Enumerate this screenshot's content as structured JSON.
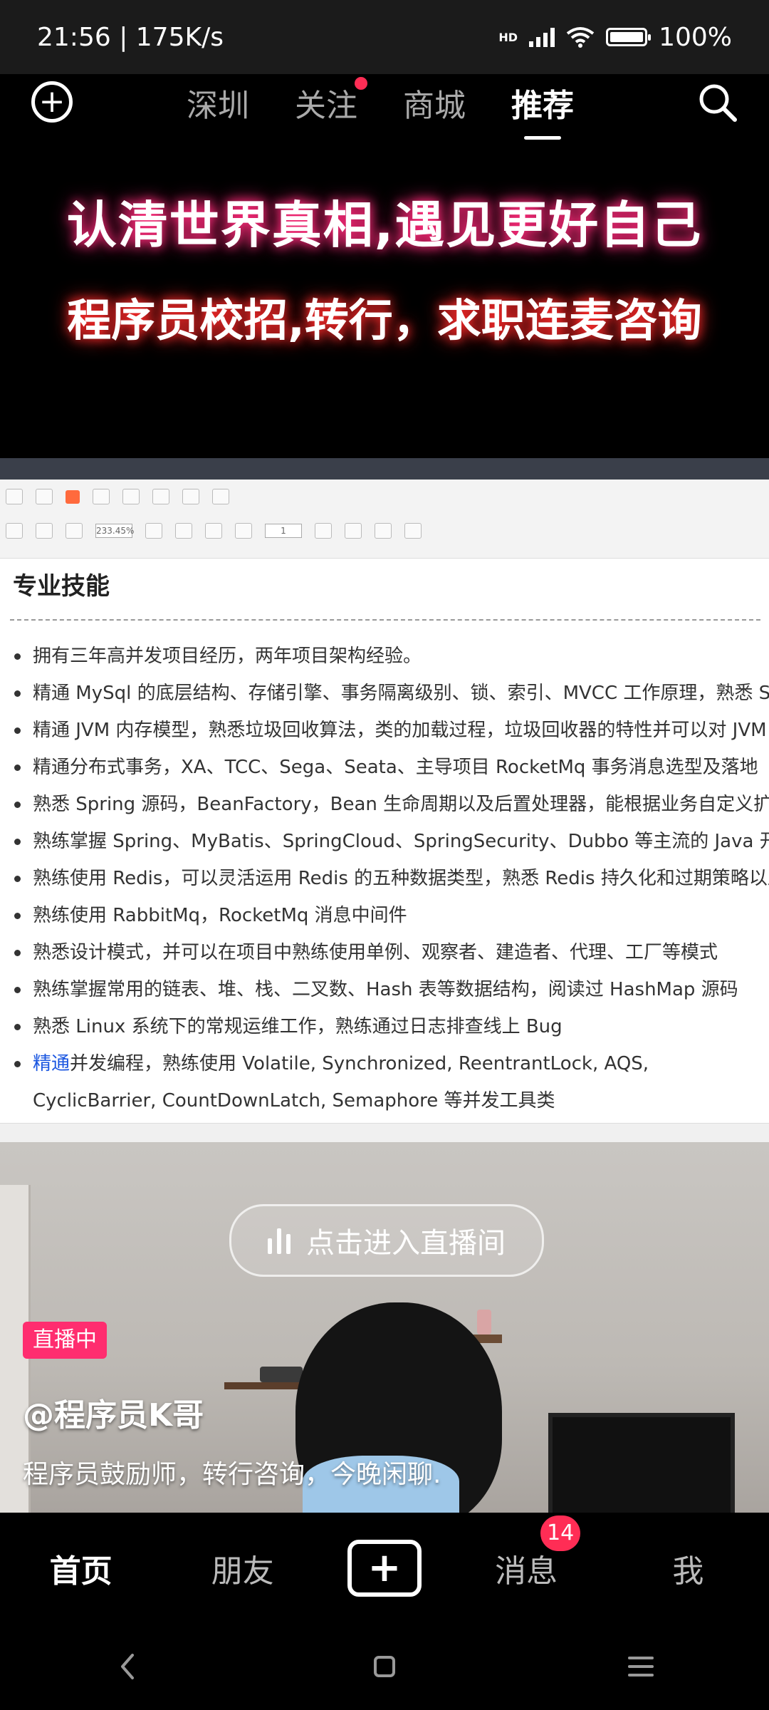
{
  "status_bar": {
    "time_speed": "21:56 | 175K/s",
    "network": "HD",
    "battery": "100%"
  },
  "top_nav": {
    "tabs": [
      {
        "label": "深圳"
      },
      {
        "label": "关注"
      },
      {
        "label": "商城"
      },
      {
        "label": "推荐"
      }
    ],
    "active_tab": "推荐"
  },
  "banner": {
    "line1": "认清世界真相,遇见更好自己",
    "line2": "程序员校招,转行，求职连麦咨询"
  },
  "document": {
    "heading": "专业技能",
    "zoom": "233.45%",
    "page_input": "1",
    "items": [
      "拥有三年高并发项目经历，两年项目架构经验。",
      "精通 MySql 的底层结构、存储引擎、事务隔离级别、锁、索引、MVCC 工作原理，熟悉 Sql 优化工作",
      "精通 JVM 内存模型，熟悉垃圾回收算法，类的加载过程，垃圾回收器的特性并可以对 JVM 进行调优",
      "精通分布式事务，XA、TCC、Sega、Seata、主导项目 RocketMq 事务消息选型及落地",
      "熟悉 Spring 源码，BeanFactory，Bean 生命周期以及后置处理器，能根据业务自定义扩展点",
      "熟练掌握 Spring、MyBatis、SpringCloud、SpringSecurity、Dubbo 等主流的 Java 开发框架",
      "熟练使用 Redis，可以灵活运用 Redis 的五种数据类型，熟悉 Redis 持久化和过期策略以及集群部署",
      "熟练使用 RabbitMq，RocketMq 消息中间件",
      "熟悉设计模式，并可以在项目中熟练使用单例、观察者、建造者、代理、工厂等模式",
      "熟练掌握常用的链表、堆、栈、二叉数、Hash 表等数据结构，阅读过 HashMap 源码",
      "熟悉 Linux 系统下的常规运维工作，熟练通过日志排查线上 Bug"
    ],
    "last_item_highlight": "精通",
    "last_item_rest": "并发编程，熟练使用 Volatile, Synchronized, ReentrantLock, AQS, CyclicBarrier, CountDownLatch, Semaphore 等并发工具类"
  },
  "live": {
    "enter_label": "点击进入直播间",
    "badge": "直播中",
    "author": "@程序员K哥",
    "description": "程序员鼓励师，转行咨询，今晚闲聊."
  },
  "bottom_nav": {
    "home": "首页",
    "friends": "朋友",
    "messages": "消息",
    "messages_badge": "14",
    "me": "我"
  },
  "colors": {
    "accent": "#ff2d55",
    "live_badge": "#ff2d6f",
    "highlight_link": "#1a56e0"
  }
}
